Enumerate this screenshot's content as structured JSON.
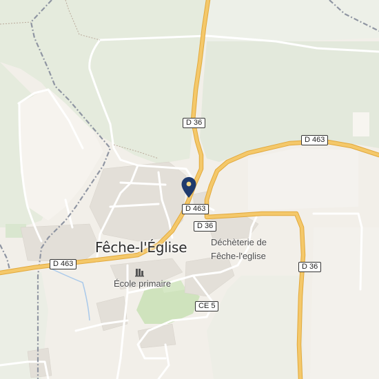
{
  "map": {
    "town_label": "Fêche-l'Église",
    "pois": {
      "school": "École primaire",
      "dechetterie_line1": "Déchèterie de",
      "dechetterie_line2": "Fêche-l'eglise"
    },
    "road_shields": {
      "d36_north": "D 36",
      "d463_east": "D 463",
      "d463_center": "D 463",
      "d36_center": "D 36",
      "d463_west": "D 463",
      "d36_southeast": "D 36",
      "ce5": "CE 5"
    },
    "icons": [
      "location-pin-icon",
      "school-icon"
    ],
    "colors": {
      "background": "#f2efe9",
      "forest": "#e4eadd",
      "grass": "#c8dfb4",
      "major_road": "#f4c86a",
      "major_road_casing": "#e2a83a",
      "minor_road": "#ffffff",
      "border_dash": "#8f95a2",
      "pin": "#1f3a6d",
      "water": "#a9c9ea"
    }
  }
}
